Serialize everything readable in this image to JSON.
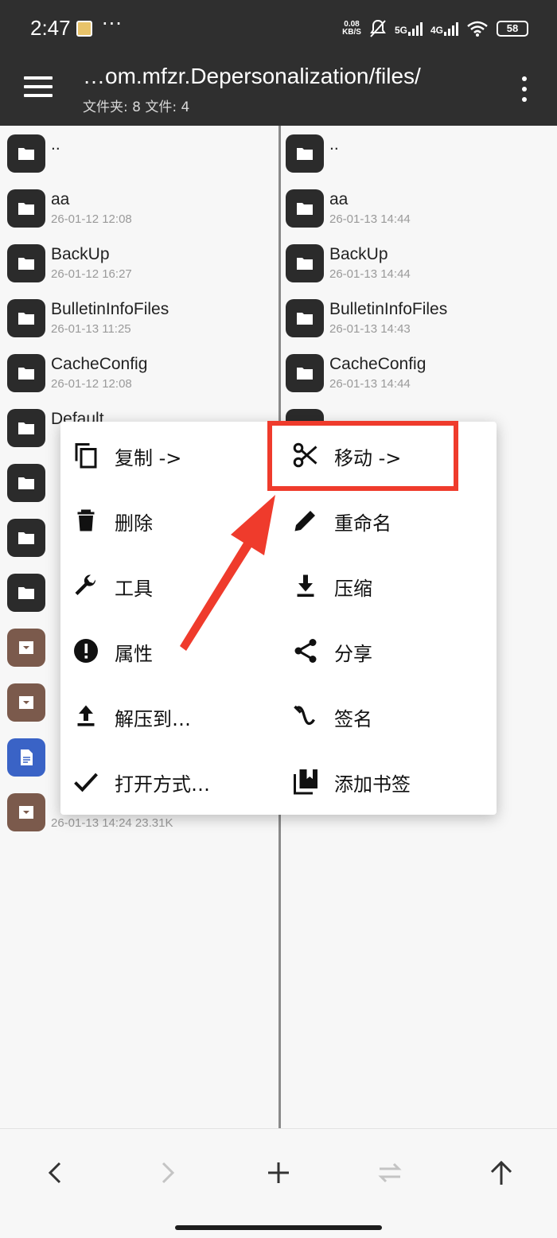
{
  "status": {
    "time": "2:47",
    "dots": "···",
    "net_speed_top": "0.08",
    "net_speed_bottom": "KB/S",
    "sig1": "5G",
    "sig2": "4G",
    "battery": "58"
  },
  "header": {
    "path": "…om.mfzr.Depersonalization/files/",
    "counts": "文件夹: 8   文件: 4"
  },
  "left_pane": {
    "items": [
      {
        "name": "..",
        "meta": "",
        "icon": "folder-icon"
      },
      {
        "name": "aa",
        "meta": "26-01-12 12:08",
        "icon": "folder-icon"
      },
      {
        "name": "BackUp",
        "meta": "26-01-12 16:27",
        "icon": "folder-icon"
      },
      {
        "name": "BulletinInfoFiles",
        "meta": "26-01-13 11:25",
        "icon": "folder-icon"
      },
      {
        "name": "CacheConfig",
        "meta": "26-01-12 12:08",
        "icon": "folder-icon"
      },
      {
        "name": "Default",
        "meta": "",
        "icon": "folder-icon"
      },
      {
        "name": "",
        "meta": "",
        "icon": "folder-icon"
      },
      {
        "name": "",
        "meta": "",
        "icon": "folder-icon"
      },
      {
        "name": "",
        "meta": "",
        "icon": "folder-icon"
      },
      {
        "name": "",
        "meta": "",
        "icon": "archive-icon"
      },
      {
        "name": "",
        "meta": "",
        "icon": "archive-icon"
      },
      {
        "name": "",
        "meta": "",
        "icon": "document-icon"
      },
      {
        "name": "",
        "meta": "26-01-13 14:24  23.31K",
        "icon": "archive-icon"
      }
    ]
  },
  "right_pane": {
    "items": [
      {
        "name": "..",
        "meta": "",
        "icon": "folder-icon"
      },
      {
        "name": "aa",
        "meta": "26-01-13 14:44",
        "icon": "folder-icon"
      },
      {
        "name": "BackUp",
        "meta": "26-01-13 14:44",
        "icon": "folder-icon"
      },
      {
        "name": "BulletinInfoFiles",
        "meta": "26-01-13 14:43",
        "icon": "folder-icon"
      },
      {
        "name": "CacheConfig",
        "meta": "26-01-13 14:44",
        "icon": "folder-icon"
      }
    ]
  },
  "context_menu": {
    "left": [
      {
        "label": "复制 ->",
        "icon": "copy-icon"
      },
      {
        "label": "删除",
        "icon": "trash-icon"
      },
      {
        "label": "工具",
        "icon": "wrench-icon"
      },
      {
        "label": "属性",
        "icon": "info-icon"
      },
      {
        "label": "解压到…",
        "icon": "upload-icon"
      },
      {
        "label": "打开方式…",
        "icon": "check-icon"
      }
    ],
    "right": [
      {
        "label": "移动 ->",
        "icon": "scissors-icon"
      },
      {
        "label": "重命名",
        "icon": "pencil-icon"
      },
      {
        "label": "压缩",
        "icon": "download-icon"
      },
      {
        "label": "分享",
        "icon": "share-icon"
      },
      {
        "label": "签名",
        "icon": "signature-icon"
      },
      {
        "label": "添加书签",
        "icon": "bookmark-icon"
      }
    ]
  },
  "colors": {
    "appbar": "#2f2f2f",
    "highlight": "#ef3b2c",
    "folder_icon_bg": "#2b2b2b",
    "archive_icon_bg": "#7b5a4c",
    "document_icon_bg": "#3a63c6"
  }
}
